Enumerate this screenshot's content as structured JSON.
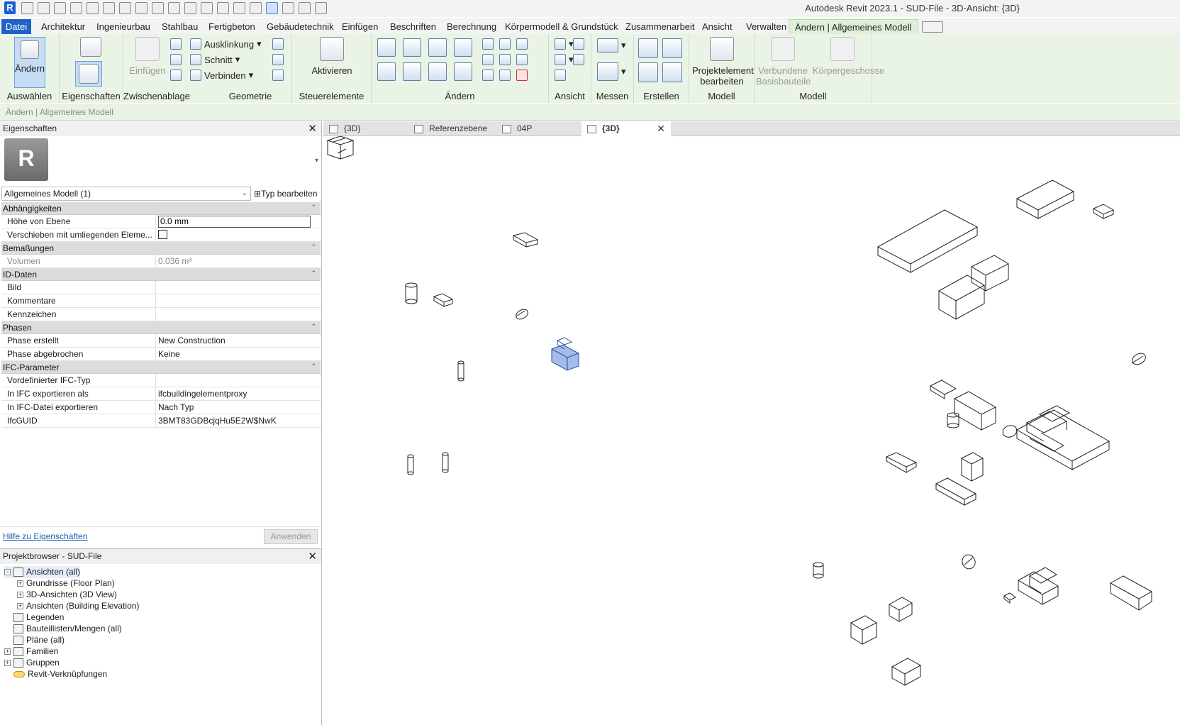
{
  "window": {
    "title": "Autodesk Revit 2023.1 - SUD-File - 3D-Ansicht: {3D}"
  },
  "app_logo": "R",
  "ribbon_tabs": [
    "Datei",
    "Architektur",
    "Ingenieurbau",
    "Stahlbau",
    "Fertigbeton",
    "Gebäudetechnik",
    "Einfügen",
    "Beschriften",
    "Berechnung",
    "Körpermodell & Grundstück",
    "Zusammenarbeit",
    "Ansicht",
    "Verwalten",
    "Ändern | Allgemeines Modell"
  ],
  "ribbon": {
    "aendern": "Ändern",
    "auswaehlen": "Auswählen",
    "eigenschaften": "Eigenschaften",
    "einfuegen": "Einfügen",
    "zwischenablage": "Zwischenablage",
    "ausklinkung": "Ausklinkung",
    "schnitt": "Schnitt",
    "verbinden": "Verbinden",
    "geometrie": "Geometrie",
    "aktivieren": "Aktivieren",
    "steuerelemente": "Steuerelemente",
    "aendern_panel": "Ändern",
    "ansicht": "Ansicht",
    "messen": "Messen",
    "erstellen": "Erstellen",
    "projektelement_1": "Projektelement",
    "projektelement_2": "bearbeiten",
    "modell1": "Modell",
    "verbundene_1": "Verbundene",
    "verbundene_2": "Basisbauteile",
    "koerpergeschosse": "Körpergeschosse",
    "modell2": "Modell"
  },
  "options_bar": "Ändern | Allgemeines Modell",
  "properties": {
    "title": "Eigenschaften",
    "type_icon": "R",
    "type_selector": "Allgemeines Modell (1)",
    "type_edit": "Typ bearbeiten",
    "groups": [
      {
        "name": "Abhängigkeiten",
        "rows": [
          {
            "key": "Höhe von Ebene",
            "value": "0.0 mm",
            "kind": "input"
          },
          {
            "key": "Verschieben mit umliegenden Eleme...",
            "value": "",
            "kind": "checkbox"
          }
        ]
      },
      {
        "name": "Bemaßungen",
        "rows": [
          {
            "key": "Volumen",
            "value": "0.036 m³",
            "kind": "readonly"
          }
        ]
      },
      {
        "name": "ID-Daten",
        "rows": [
          {
            "key": "Bild",
            "value": ""
          },
          {
            "key": "Kommentare",
            "value": ""
          },
          {
            "key": "Kennzeichen",
            "value": ""
          }
        ]
      },
      {
        "name": "Phasen",
        "rows": [
          {
            "key": "Phase erstellt",
            "value": "New Construction"
          },
          {
            "key": "Phase abgebrochen",
            "value": "Keine"
          }
        ]
      },
      {
        "name": "IFC-Parameter",
        "rows": [
          {
            "key": "Vordefinierter IFC-Typ",
            "value": ""
          },
          {
            "key": "In IFC exportieren als",
            "value": "ifcbuildingelementproxy"
          },
          {
            "key": "In IFC-Datei exportieren",
            "value": "Nach Typ"
          },
          {
            "key": "IfcGUID",
            "value": "3BMT83GDBcjqHu5E2W$NwK"
          }
        ]
      }
    ],
    "help_link": "Hilfe zu Eigenschaften",
    "apply": "Anwenden"
  },
  "project_browser": {
    "title": "Projektbrowser - SUD-File",
    "nodes": [
      {
        "label": "Ansichten (all)",
        "level": 0,
        "toggle": "−",
        "selected": true
      },
      {
        "label": "Grundrisse (Floor Plan)",
        "level": 1,
        "toggle": "+"
      },
      {
        "label": "3D-Ansichten (3D View)",
        "level": 1,
        "toggle": "+"
      },
      {
        "label": "Ansichten (Building Elevation)",
        "level": 1,
        "toggle": "+"
      },
      {
        "label": "Legenden",
        "level": 0,
        "toggle": ""
      },
      {
        "label": "Bauteillisten/Mengen (all)",
        "level": 0,
        "toggle": ""
      },
      {
        "label": "Pläne (all)",
        "level": 0,
        "toggle": ""
      },
      {
        "label": "Familien",
        "level": 0,
        "toggle": "+"
      },
      {
        "label": "Gruppen",
        "level": 0,
        "toggle": "+"
      },
      {
        "label": "Revit-Verknüpfungen",
        "level": 0,
        "toggle": "",
        "icon": "link"
      }
    ]
  },
  "view_tabs": [
    {
      "label": "{3D}",
      "active": false
    },
    {
      "label": "Referenzebene",
      "active": false
    },
    {
      "label": "04P",
      "active": false
    },
    {
      "label": "{3D}",
      "active": true
    }
  ],
  "colors": {
    "accent": "#1f63c6",
    "context_tab": "#dff0d8",
    "selection": "#7f9fe0"
  }
}
